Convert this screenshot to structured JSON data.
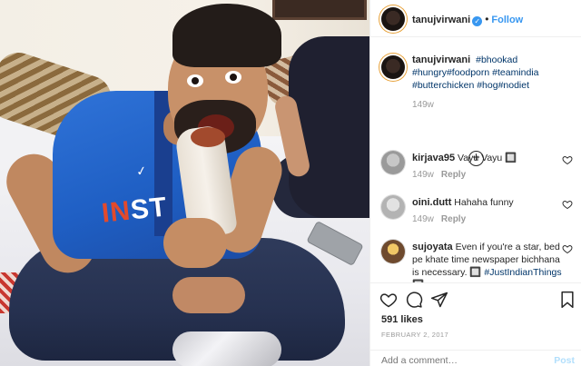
{
  "post": {
    "username": "tanujvirwani",
    "verified": true,
    "follow_label": "Follow",
    "separator": "•",
    "caption_username": "tanujvirwani",
    "caption_tags": "#bhookad #hungry#foodporn #teamindia #butterchicken #hog#nodiet",
    "caption_age": "149w",
    "load_more": "+",
    "likes": "591 likes",
    "date": "FEBRUARY 2, 2017"
  },
  "photo": {
    "jersey_text_a": "IN",
    "jersey_text_b": "ST",
    "swoosh": "✓"
  },
  "comments": [
    {
      "username": "kirjava95",
      "text": "Vayu Vayu 🔲",
      "age": "149w",
      "reply": "Reply"
    },
    {
      "username": "oini.dutt",
      "text": "Hahaha funny",
      "age": "149w",
      "reply": "Reply"
    },
    {
      "username": "sujoyata",
      "text": "Even if you're a star, bed pe khate time newspaper bichhana is necessary. 🔲",
      "tag": "#JustIndianThings 🔲"
    }
  ],
  "input": {
    "placeholder": "Add a comment…",
    "post_label": "Post"
  },
  "colors": {
    "accent": "#3897f0",
    "hashtag": "#003569",
    "muted": "#999999",
    "post_disabled": "#b2dffc"
  },
  "icons": [
    "verified-icon",
    "add-circle-icon",
    "heart-icon",
    "comment-icon",
    "share-icon",
    "bookmark-icon"
  ]
}
